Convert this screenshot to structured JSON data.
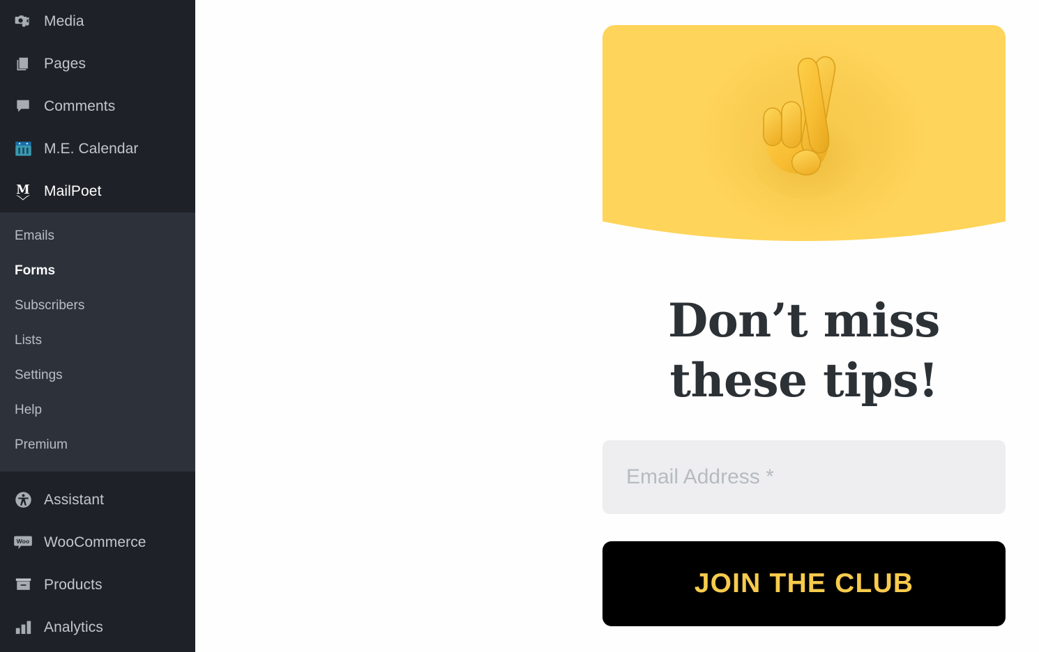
{
  "sidebar": {
    "background_color": "#1e2228",
    "submenu_background_color": "#2c313a",
    "primary_items": [
      {
        "label": "Media",
        "icon": "media-icon",
        "active": false
      },
      {
        "label": "Pages",
        "icon": "pages-icon",
        "active": false
      },
      {
        "label": "Comments",
        "icon": "comments-icon",
        "active": false
      },
      {
        "label": "M.E. Calendar",
        "icon": "calendar-icon",
        "active": false
      },
      {
        "label": "MailPoet",
        "icon": "mailpoet-icon",
        "active": true
      }
    ],
    "submenu_items": [
      {
        "label": "Emails",
        "current": false
      },
      {
        "label": "Forms",
        "current": true
      },
      {
        "label": "Subscribers",
        "current": false
      },
      {
        "label": "Lists",
        "current": false
      },
      {
        "label": "Settings",
        "current": false
      },
      {
        "label": "Help",
        "current": false
      },
      {
        "label": "Premium",
        "current": false
      }
    ],
    "lower_items": [
      {
        "label": "Assistant",
        "icon": "accessibility-icon"
      },
      {
        "label": "WooCommerce",
        "icon": "woocommerce-icon"
      },
      {
        "label": "Products",
        "icon": "products-icon"
      },
      {
        "label": "Analytics",
        "icon": "analytics-icon"
      }
    ]
  },
  "form": {
    "hero": {
      "background_color": "#ffd45a",
      "emoji_name": "crossed-fingers-emoji",
      "emoji_glyph": "🤞"
    },
    "headline_line1": "Don’t miss",
    "headline_line2": "these tips!",
    "headline_color": "#2c3136",
    "email": {
      "placeholder": "Email Address *",
      "value": "",
      "background_color": "#eeeef0"
    },
    "submit": {
      "label": "JOIN THE CLUB",
      "background_color": "#000000",
      "text_color": "#f7cb4c"
    }
  }
}
